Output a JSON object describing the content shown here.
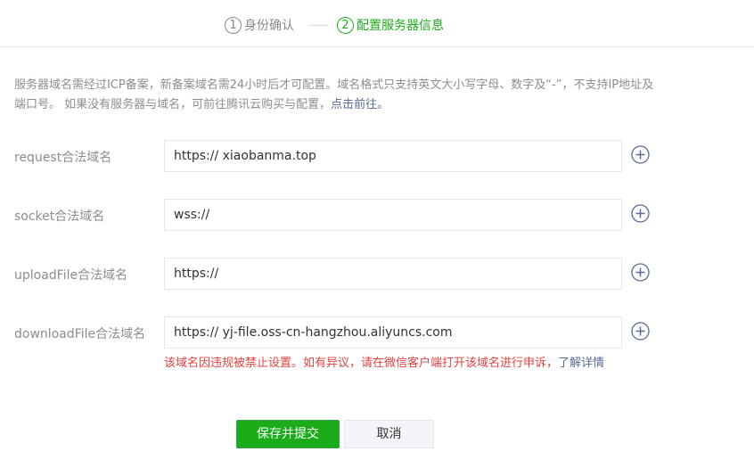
{
  "steps": [
    {
      "num": "1",
      "label": "身份确认",
      "state": "done"
    },
    {
      "num": "2",
      "label": "配置服务器信息",
      "state": "active"
    }
  ],
  "notice": {
    "text": "服务器域名需经过ICP备案，新备案域名需24小时后才可配置。域名格式只支持英文大小写字母、数字及“-”，不支持IP地址及端口号。 如果没有服务器与域名，可前往腾讯云购买与配置，",
    "link": "点击前往。"
  },
  "rows": [
    {
      "label": "request合法域名",
      "value": "https:// xiaobanma.top"
    },
    {
      "label": "socket合法域名",
      "value": "wss://"
    },
    {
      "label": "uploadFile合法域名",
      "value": "https://"
    },
    {
      "label": "downloadFile合法域名",
      "value": "https:// yj-file.oss-cn-hangzhou.aliyuncs.com"
    }
  ],
  "add_icon": "plus-circle-icon",
  "error": {
    "text": "该域名因违规被禁止设置。如有异议，请在微信客户端打开该域名进行申诉，",
    "link": "了解详情"
  },
  "buttons": {
    "save": "保存并提交",
    "cancel": "取消"
  },
  "colors": {
    "accent": "#1aad19",
    "error": "#e64340",
    "link": "#576b95",
    "muted": "#8d8d8d"
  }
}
